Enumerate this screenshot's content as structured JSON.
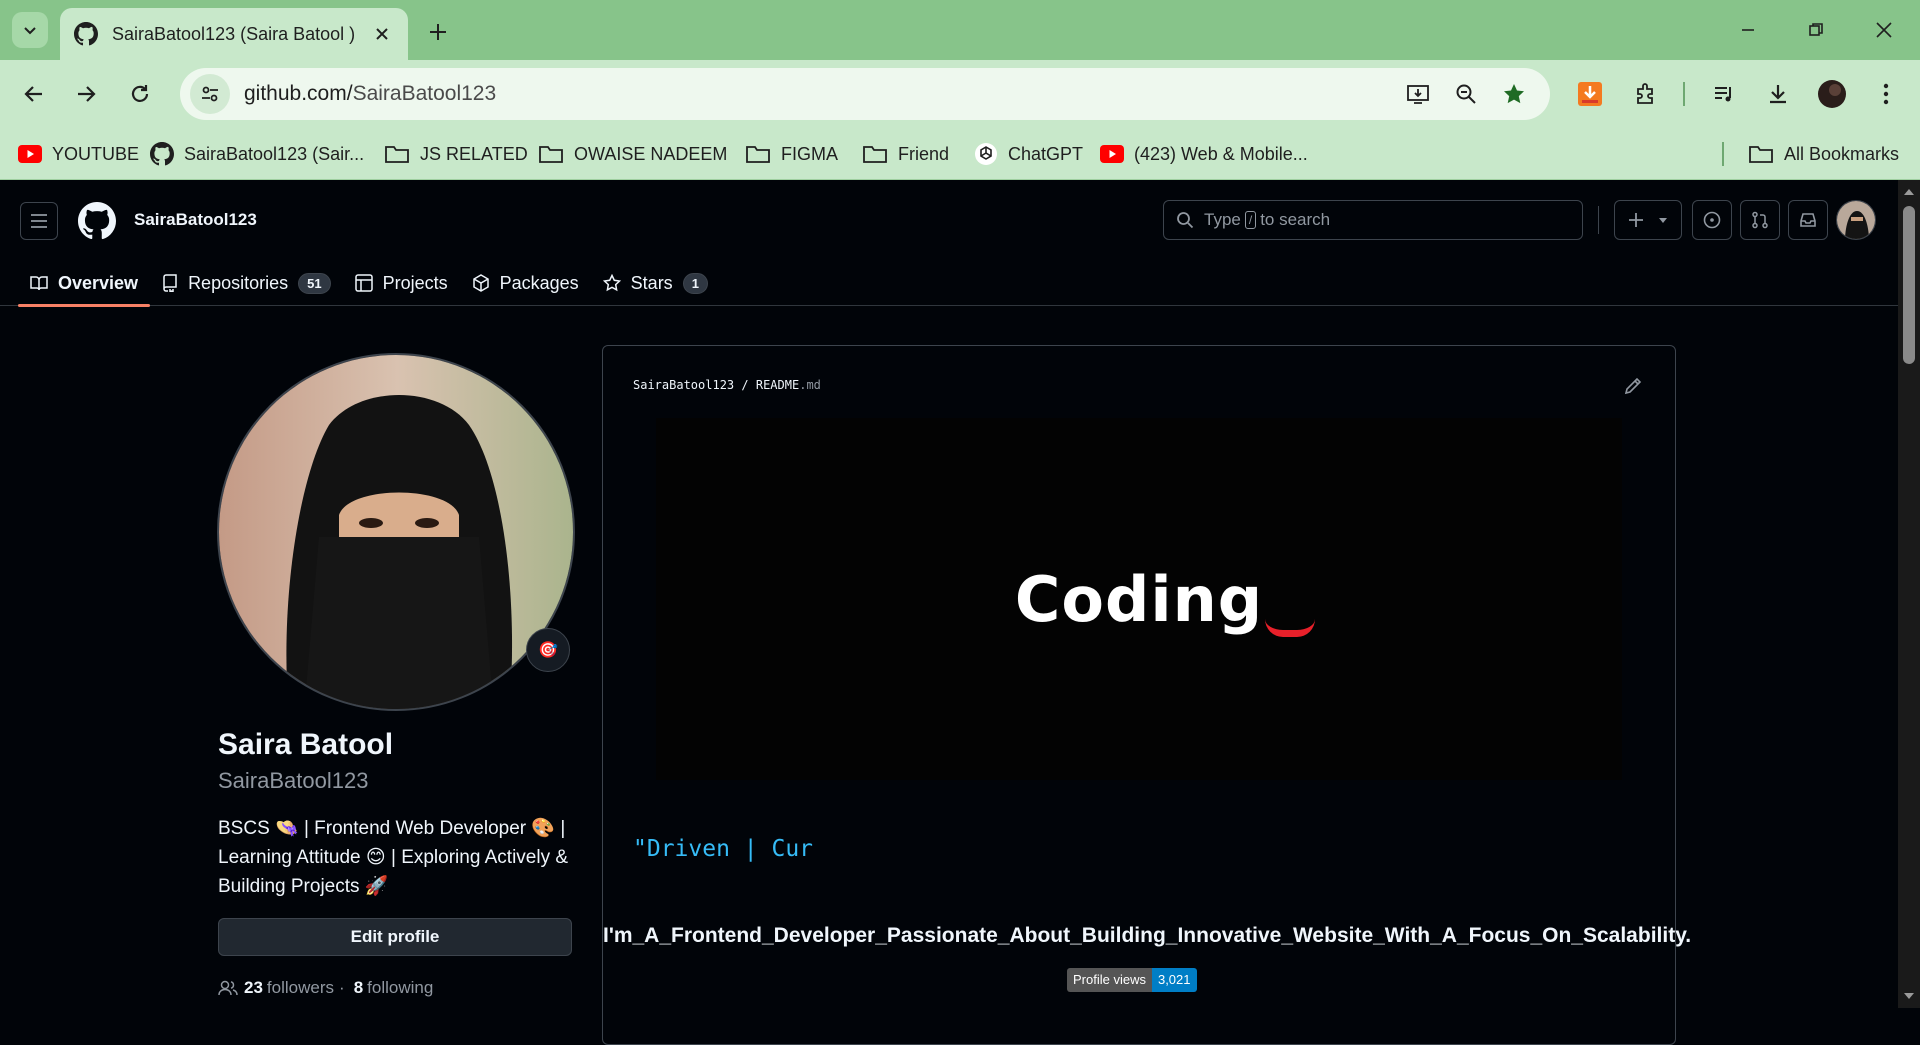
{
  "browser": {
    "tab_title": "SairaBatool123 (Saira Batool )",
    "url_host": "github.com/",
    "url_path": "SairaBatool123",
    "bookmarks": [
      {
        "label": "YOUTUBE",
        "icon": "youtube-icon"
      },
      {
        "label": "SairaBatool123 (Sair...",
        "icon": "github-icon"
      },
      {
        "label": "JS RELATED",
        "icon": "folder-icon"
      },
      {
        "label": "OWAISE NADEEM",
        "icon": "folder-icon"
      },
      {
        "label": "FIGMA",
        "icon": "folder-icon"
      },
      {
        "label": "Friend",
        "icon": "folder-icon"
      },
      {
        "label": "ChatGPT",
        "icon": "chatgpt-icon"
      },
      {
        "label": "(423) Web & Mobile...",
        "icon": "youtube-icon"
      }
    ],
    "all_bookmarks": "All Bookmarks"
  },
  "github": {
    "username": "SairaBatool123",
    "search": {
      "prefix": "Type",
      "key": "/",
      "suffix": "to search"
    },
    "tabs": [
      {
        "label": "Overview",
        "icon": "book-icon"
      },
      {
        "label": "Repositories",
        "icon": "repo-icon",
        "count": "51"
      },
      {
        "label": "Projects",
        "icon": "table-icon"
      },
      {
        "label": "Packages",
        "icon": "package-icon"
      },
      {
        "label": "Stars",
        "icon": "star-icon",
        "count": "1"
      }
    ]
  },
  "profile": {
    "name": "Saira Batool",
    "login": "SairaBatool123",
    "status_emoji": "🎯",
    "bio": "BSCS 👒 | Frontend Web Developer 🎨 | Learning Attitude 😊 | Exploring Actively & Building Projects 🚀",
    "edit_label": "Edit profile",
    "followers_count": "23",
    "followers_label": "followers",
    "dot": "·",
    "following_count": "8",
    "following_label": "following"
  },
  "readme": {
    "owner": "SairaBatool123",
    "sep": "/",
    "file_name": "README",
    "file_ext": ".md",
    "banner_text": "Coding",
    "typing_text": "\"Driven | Cur",
    "tagline": "I'm_A_Frontend_Developer_Passionate_About_Building_Innovative_Website_With_A_Focus_On_Scalability.",
    "badge_label": "Profile views",
    "badge_value": "3,021"
  },
  "colors": {
    "chrome": "#87c48a",
    "toolbar": "#c8e8ca",
    "gh_bg": "#010409",
    "accent": "#f78166",
    "typing": "#36bcf7"
  }
}
